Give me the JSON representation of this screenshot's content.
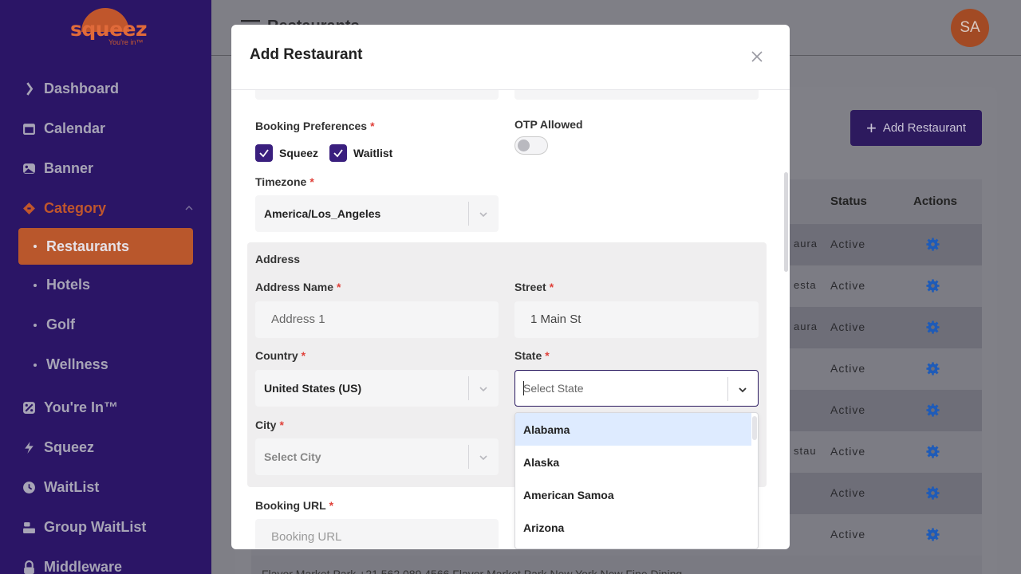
{
  "brand": {
    "logo_text": "squeez",
    "tagline": "You're in™"
  },
  "sidebar": {
    "items": [
      {
        "label": "Dashboard",
        "icon": "dashboard-icon"
      },
      {
        "label": "Calendar",
        "icon": "calendar-icon"
      },
      {
        "label": "Banner",
        "icon": "image-icon"
      },
      {
        "label": "Category",
        "icon": "category-icon"
      },
      {
        "label": "You're In™",
        "icon": "percent-icon"
      },
      {
        "label": "Squeez",
        "icon": "bolt-icon"
      },
      {
        "label": "WaitList",
        "icon": "clock-icon"
      },
      {
        "label": "Group WaitList",
        "icon": "group-icon"
      },
      {
        "label": "Middleware",
        "icon": "lock-icon"
      }
    ],
    "sub_items": [
      "Restaurants",
      "Hotels",
      "Golf",
      "Wellness"
    ]
  },
  "header": {
    "title": "Restaurants",
    "avatar_initials": "SA"
  },
  "page": {
    "add_button": "Add Restaurant",
    "columns": {
      "status": "Status",
      "actions": "Actions"
    },
    "rows": [
      {
        "name_fragment": "aura",
        "status": "Active"
      },
      {
        "name_fragment": "esta",
        "status": "Active"
      },
      {
        "name_fragment": "aura",
        "status": "Active"
      },
      {
        "name_fragment": "",
        "status": "Active"
      },
      {
        "name_fragment": "",
        "status": "Active"
      },
      {
        "name_fragment": "stau",
        "status": "Active"
      },
      {
        "name_fragment": "",
        "status": "Active"
      },
      {
        "name_fragment": "",
        "status": "Active"
      }
    ],
    "partial_row_text": "Flavor Market Park  +21 562 089 4566  Flavor Market Park New York New Fine Dining"
  },
  "modal": {
    "title": "Add Restaurant",
    "booking_preferences": {
      "label": "Booking Preferences",
      "options": [
        {
          "label": "Squeez",
          "checked": true
        },
        {
          "label": "Waitlist",
          "checked": true
        }
      ]
    },
    "otp": {
      "label": "OTP Allowed",
      "enabled": false
    },
    "timezone": {
      "label": "Timezone",
      "value": "America/Los_Angeles"
    },
    "address": {
      "section_label": "Address",
      "name": {
        "label": "Address Name",
        "value": "Address 1"
      },
      "street": {
        "label": "Street",
        "value": "1 Main St"
      },
      "country": {
        "label": "Country",
        "value": "United States (US)"
      },
      "state": {
        "label": "State",
        "placeholder": "Select State"
      },
      "city": {
        "label": "City",
        "placeholder": "Select City"
      }
    },
    "booking_url": {
      "label": "Booking URL",
      "placeholder": "Booking URL"
    },
    "state_options": [
      "Alabama",
      "Alaska",
      "American Samoa",
      "Arizona"
    ]
  },
  "colors": {
    "sidebar": "#2b1566",
    "accent": "#c0562c",
    "primary": "#3a1f7e",
    "required": "#e0413a",
    "gear": "#1e5bb8"
  }
}
